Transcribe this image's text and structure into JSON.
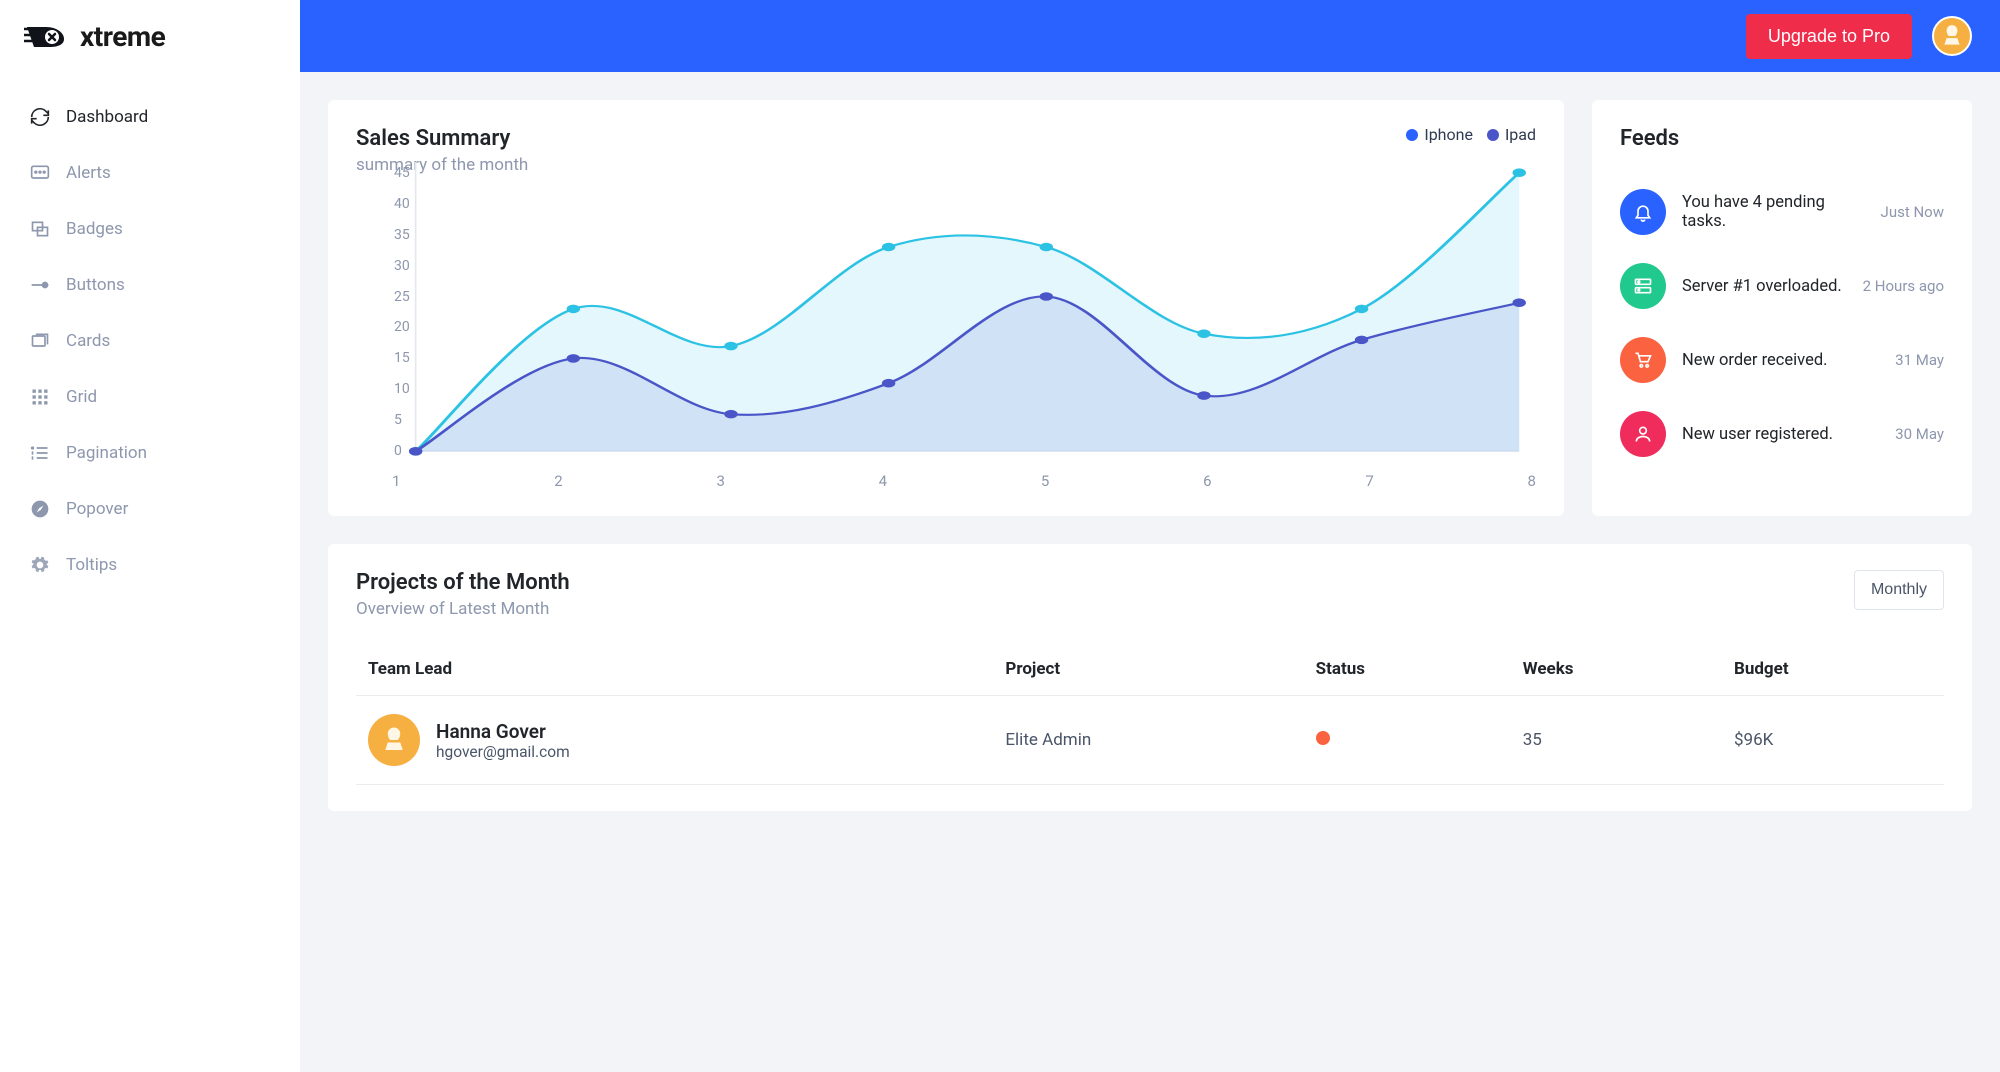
{
  "brand": {
    "name": "xtreme"
  },
  "sidebar": {
    "items": [
      {
        "label": "Dashboard"
      },
      {
        "label": "Alerts"
      },
      {
        "label": "Badges"
      },
      {
        "label": "Buttons"
      },
      {
        "label": "Cards"
      },
      {
        "label": "Grid"
      },
      {
        "label": "Pagination"
      },
      {
        "label": "Popover"
      },
      {
        "label": "Toltips"
      }
    ]
  },
  "topbar": {
    "upgrade": "Upgrade to Pro"
  },
  "sales": {
    "title": "Sales Summary",
    "subtitle": "summary of the month",
    "legend": [
      {
        "label": "Iphone",
        "color": "#2962ff"
      },
      {
        "label": "Ipad",
        "color": "#4a55c8"
      }
    ]
  },
  "chart_data": {
    "type": "line",
    "title": "Sales Summary",
    "xlabel": "",
    "ylabel": "",
    "ylim": [
      0,
      45
    ],
    "categories": [
      "1",
      "2",
      "3",
      "4",
      "5",
      "6",
      "7",
      "8"
    ],
    "yticks": [
      0,
      5,
      10,
      15,
      20,
      25,
      30,
      35,
      40,
      45
    ],
    "series": [
      {
        "name": "Iphone",
        "color": "#2cc2e4",
        "values": [
          0,
          23,
          17,
          33,
          33,
          19,
          23,
          45
        ]
      },
      {
        "name": "Ipad",
        "color": "#4a55c8",
        "values": [
          0,
          15,
          6,
          11,
          25,
          9,
          18,
          24
        ]
      }
    ]
  },
  "feeds": {
    "title": "Feeds",
    "items": [
      {
        "icon": "bell",
        "bg": "#2962ff",
        "text": "You have 4 pending tasks.",
        "time": "Just Now"
      },
      {
        "icon": "server",
        "bg": "#22c98e",
        "text": "Server #1 overloaded.",
        "time": "2 Hours ago"
      },
      {
        "icon": "cart",
        "bg": "#fb6340",
        "text": "New order received.",
        "time": "31 May"
      },
      {
        "icon": "user",
        "bg": "#ef2c5b",
        "text": "New user registered.",
        "time": "30 May"
      }
    ]
  },
  "projects": {
    "title": "Projects of the Month",
    "subtitle": "Overview of Latest Month",
    "dropdown": "Monthly",
    "columns": {
      "lead": "Team Lead",
      "project": "Project",
      "status": "Status",
      "weeks": "Weeks",
      "budget": "Budget"
    },
    "rows": [
      {
        "name": "Hanna Gover",
        "email": "hgover@gmail.com",
        "project": "Elite Admin",
        "status_color": "#fb6340",
        "weeks": "35",
        "budget": "$96K"
      }
    ]
  }
}
